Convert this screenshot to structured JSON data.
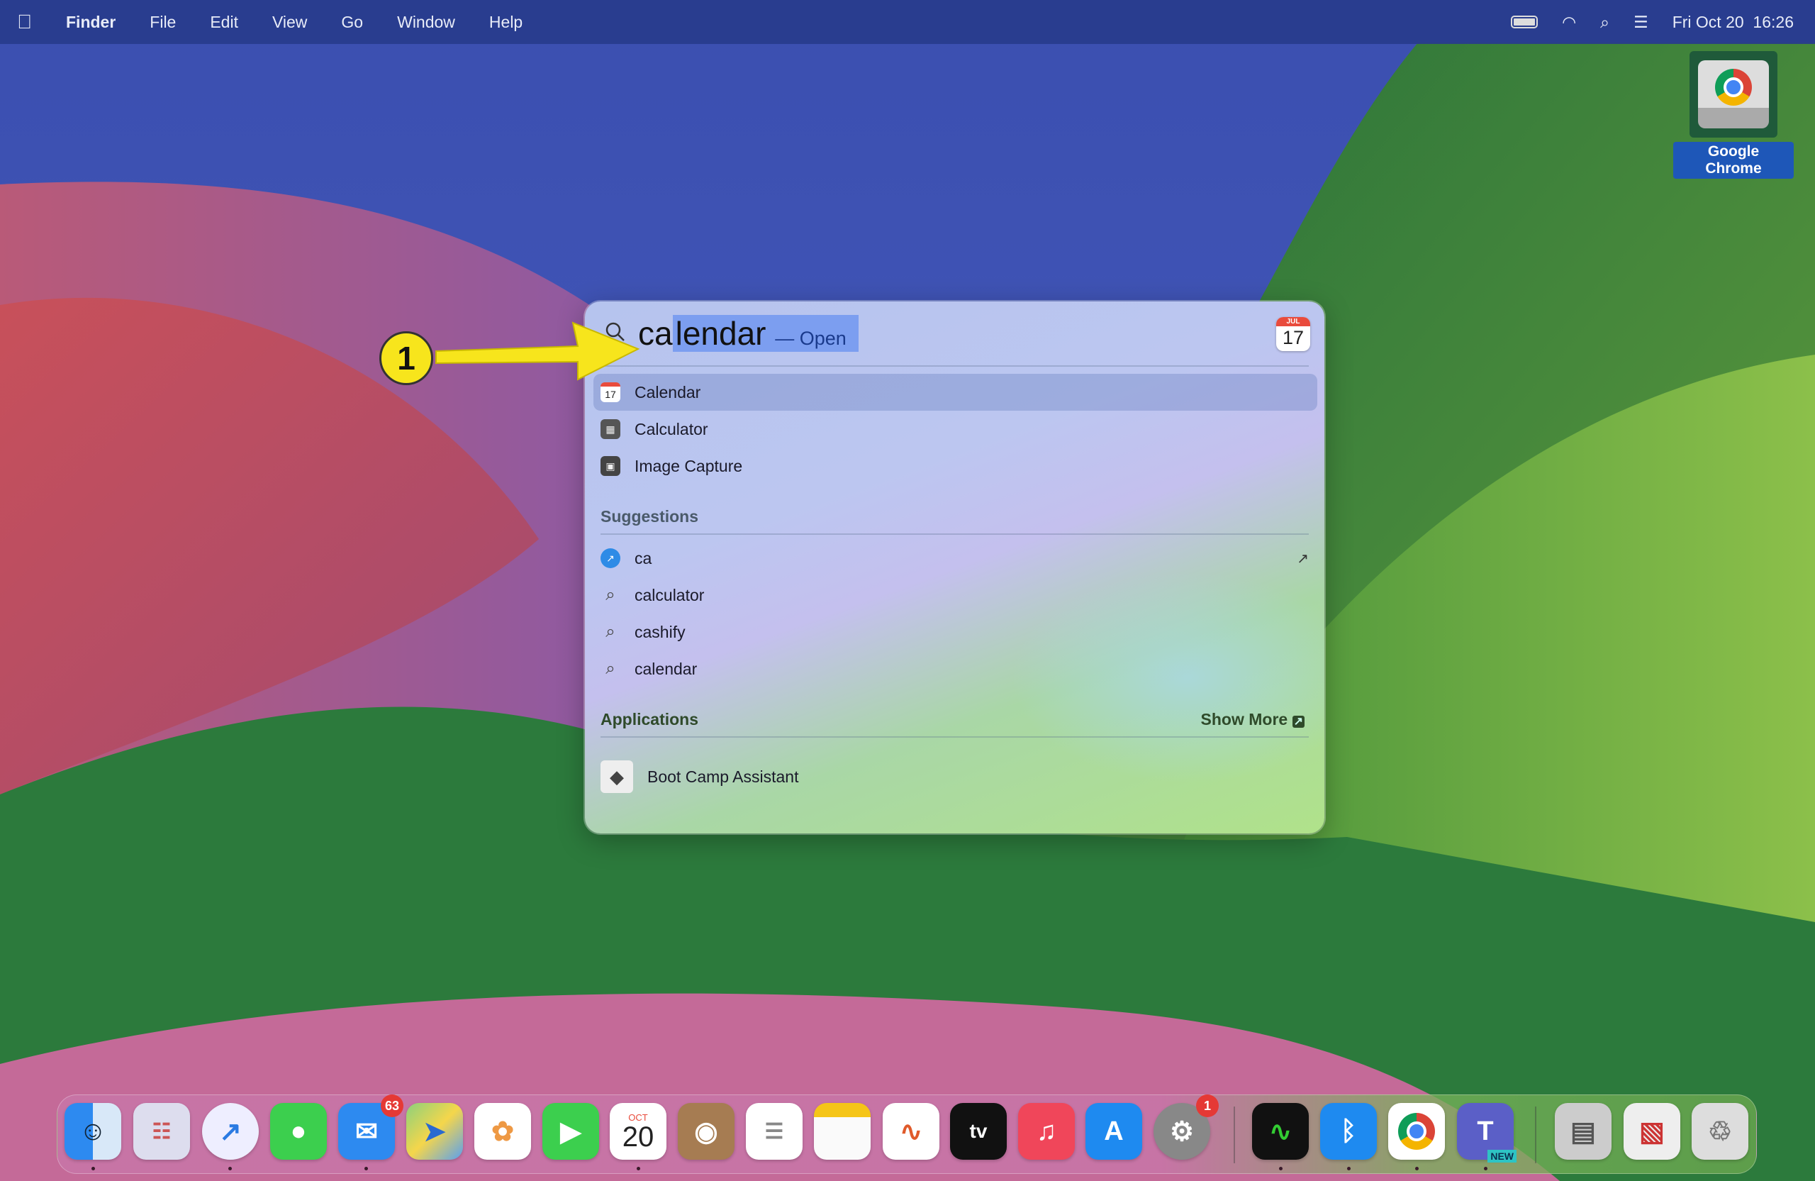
{
  "menubar": {
    "apple": "",
    "app": "Finder",
    "items": [
      "File",
      "Edit",
      "View",
      "Go",
      "Window",
      "Help"
    ],
    "datetime": "Fri Oct 20  16:26"
  },
  "desktop": {
    "icon_label": "Google Chrome"
  },
  "spotlight": {
    "query_prefix": "ca",
    "query_completion": "lendar",
    "open_hint": "— Open",
    "preview_month": "JUL",
    "preview_day": "17",
    "top_hits": [
      {
        "label": "Calendar",
        "icon": "calendar-icon"
      },
      {
        "label": "Calculator",
        "icon": "calculator-icon"
      },
      {
        "label": "Image Capture",
        "icon": "image-capture-icon"
      }
    ],
    "suggestions_header": "Suggestions",
    "suggestions": [
      {
        "label": "ca",
        "icon": "safari-icon"
      },
      {
        "label": "calculator",
        "icon": "search-icon"
      },
      {
        "label": "cashify",
        "icon": "search-icon"
      },
      {
        "label": "calendar",
        "icon": "search-icon"
      }
    ],
    "applications_header": "Applications",
    "show_more": "Show More",
    "applications": [
      {
        "label": "Boot Camp Assistant",
        "icon": "boot-camp-icon"
      }
    ]
  },
  "annotation": {
    "step": "1",
    "color": "#f7e51c"
  },
  "dock": {
    "mail_badge": "63",
    "settings_badge": "1",
    "calendar_month": "OCT",
    "calendar_day": "20",
    "teams_badge": "NEW",
    "tv_label": "tv"
  }
}
